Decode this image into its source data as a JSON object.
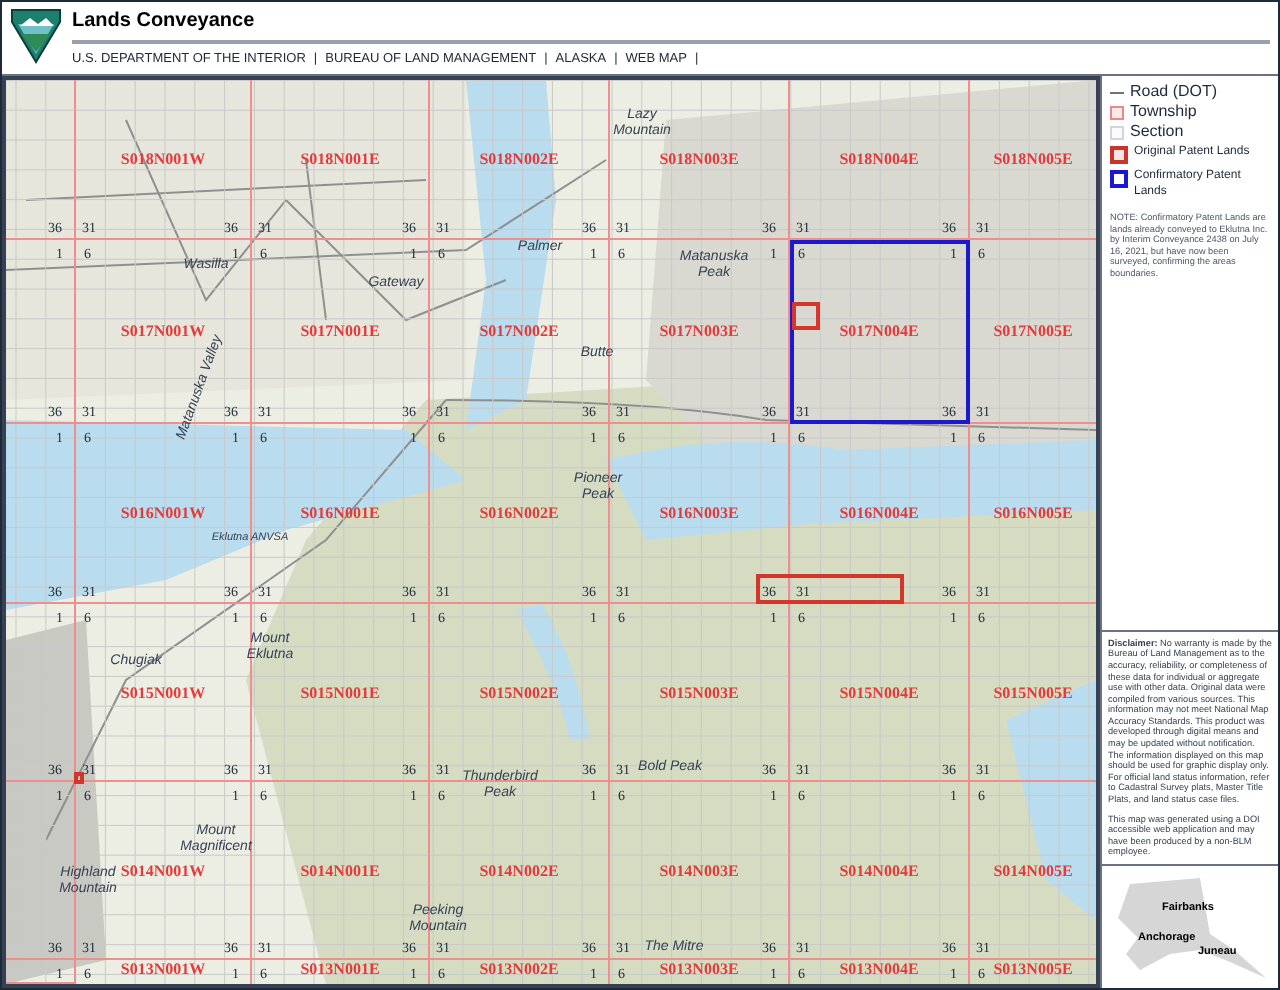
{
  "header": {
    "title": "Lands Conveyance",
    "nav": [
      "U.S. DEPARTMENT OF THE INTERIOR",
      "BUREAU OF LAND MANAGEMENT",
      "ALASKA",
      "WEB MAP"
    ],
    "separator": "|"
  },
  "map": {
    "townships": [
      [
        "S018N001W",
        "S018N001E",
        "S018N002E",
        "S018N003E",
        "S018N004E",
        "S018N005E"
      ],
      [
        "S017N001W",
        "S017N001E",
        "S017N002E",
        "S017N003E",
        "S017N004E",
        "S017N005E"
      ],
      [
        "S016N001W",
        "S016N001E",
        "S016N002E",
        "S016N003E",
        "S016N004E",
        "S016N005E"
      ],
      [
        "S015N001W",
        "S015N001E",
        "S015N002E",
        "S015N003E",
        "S015N004E",
        "S015N005E"
      ],
      [
        "S014N001W",
        "S014N001E",
        "S014N002E",
        "S014N003E",
        "S014N004E",
        "S014N005E"
      ],
      [
        "S013N001W",
        "S013N001E",
        "S013N002E",
        "S013N003E",
        "S013N004E",
        "S013N005E"
      ]
    ],
    "section_corners": [
      [
        [
          "36",
          "31",
          "1",
          "6"
        ],
        [
          "36",
          "31",
          "1",
          "6"
        ],
        [
          "36",
          "31",
          "1",
          "6"
        ],
        [
          "36",
          "31",
          "1",
          "6"
        ],
        [
          "36",
          "31",
          "1",
          "6"
        ],
        [
          "36",
          "31",
          "1",
          "6"
        ]
      ],
      [
        [
          "36",
          "31",
          "1",
          "6"
        ],
        [
          "36",
          "31",
          "1",
          "6"
        ],
        [
          "36",
          "31",
          "1",
          "6"
        ],
        [
          "36",
          "31",
          "1",
          "6"
        ],
        [
          "36",
          "31",
          "1",
          "6"
        ],
        [
          "36",
          "31",
          "1",
          "6"
        ]
      ],
      [
        [
          "36",
          "31",
          "1",
          "6"
        ],
        [
          "36",
          "31",
          "1",
          "6"
        ],
        [
          "36",
          "31",
          "1",
          "6"
        ],
        [
          "36",
          "31",
          "1",
          "6"
        ],
        [
          "36",
          "31",
          "1",
          "6"
        ],
        [
          "36",
          "31",
          "1",
          "6"
        ]
      ],
      [
        [
          "36",
          "31",
          "1",
          "6"
        ],
        [
          "36",
          "31",
          "1",
          "6"
        ],
        [
          "36",
          "31",
          "1",
          "6"
        ],
        [
          "36",
          "31",
          "1",
          "6"
        ],
        [
          "36",
          "31",
          "1",
          "6"
        ],
        [
          "36",
          "31",
          "1",
          "6"
        ]
      ],
      [
        [
          "36",
          "31",
          "1",
          "6"
        ],
        [
          "36",
          "31",
          "1",
          "6"
        ],
        [
          "36",
          "31",
          "1",
          "6"
        ],
        [
          "36",
          "31",
          "1",
          "6"
        ],
        [
          "36",
          "31",
          "1",
          "6"
        ],
        [
          "36",
          "31",
          "1",
          "6"
        ]
      ]
    ],
    "places": [
      "Wasilla",
      "Gateway",
      "Palmer",
      "Butte",
      "Lazy Mountain",
      "Matanuska Peak",
      "Pioneer Peak",
      "Eklutna ANVSA",
      "Mount Eklutna",
      "Chugiak",
      "Mount Magnificent",
      "Highland Mountain",
      "Thunderbird Peak",
      "Bold Peak",
      "Peeking Mountain",
      "The Mitre",
      "Matanuska Valley"
    ],
    "parcels": [
      {
        "kind": "confirmatory"
      },
      {
        "kind": "original"
      },
      {
        "kind": "original"
      },
      {
        "kind": "original"
      }
    ]
  },
  "legend": {
    "items": [
      {
        "kind": "road",
        "label": "Road (DOT)"
      },
      {
        "kind": "township",
        "label": "Township"
      },
      {
        "kind": "section",
        "label": "Section"
      },
      {
        "kind": "original",
        "label": "Original Patent Lands"
      },
      {
        "kind": "confirmatory",
        "label": "Confirmatory Patent Lands"
      }
    ],
    "note": "NOTE: Confirmatory Patent Lands are lands already conveyed to Eklutna Inc. by Interim Conveyance 2438 on July 16, 2021, but have now been surveyed, confirming the areas boundaries."
  },
  "disclaimer": [
    "**Disclaimer:** No warranty is made by the Bureau of Land Management as to the accuracy, reliability, or completeness of these data for individual or aggregate use with other data. Original data were compiled from various sources. This information may not meet National Map Accuracy Standards. This product was developed through digital means and may be updated without notification. The information displayed on this map should be used for graphic display only. For official land status information, refer to Cadastral Survey plats, Master Title Plats, and land status case files.",
    "This map was generated using a DOI accessible web application and may have been produced by a non-BLM employee."
  ],
  "inset": {
    "cities": [
      "Fairbanks",
      "Anchorage",
      "Juneau"
    ]
  }
}
